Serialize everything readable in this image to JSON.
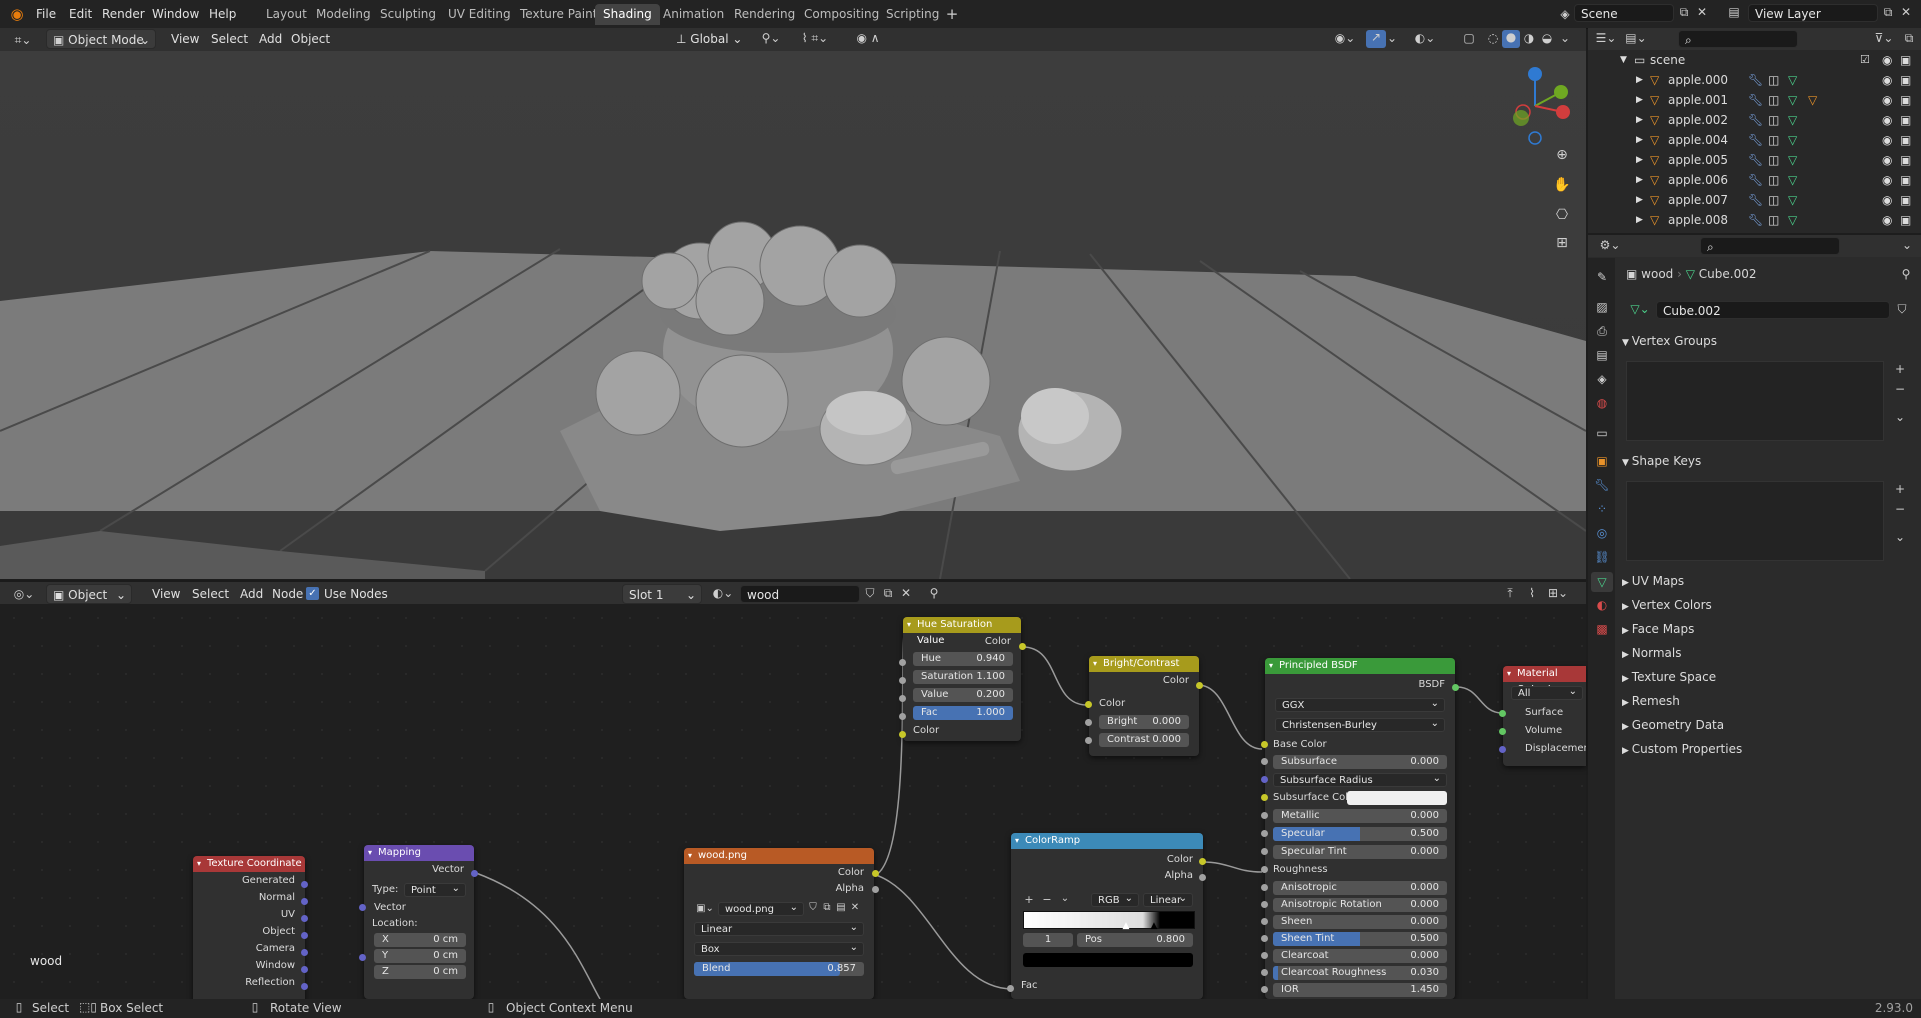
{
  "topbar": {
    "menus": [
      "File",
      "Edit",
      "Render",
      "Window",
      "Help"
    ],
    "workspaces": [
      "Layout",
      "Modeling",
      "Sculpting",
      "UV Editing",
      "Texture Paint",
      "Shading",
      "Animation",
      "Rendering",
      "Compositing",
      "Scripting"
    ],
    "active_workspace": "Shading",
    "scene": "Scene",
    "view_layer": "View Layer"
  },
  "viewport_header": {
    "mode": "Object Mode",
    "menus": [
      "View",
      "Select",
      "Add",
      "Object"
    ],
    "orientation": "Global"
  },
  "node_header": {
    "type": "Object",
    "menus": [
      "View",
      "Select",
      "Add",
      "Node"
    ],
    "use_nodes_label": "Use Nodes",
    "slot": "Slot 1",
    "material": "wood"
  },
  "node_editor": {
    "material_label": "wood",
    "nodes": {
      "tex_coord": {
        "title": "Texture Coordinate",
        "outputs": [
          "Generated",
          "Normal",
          "UV",
          "Object",
          "Camera",
          "Window",
          "Reflection"
        ]
      },
      "mapping": {
        "title": "Mapping",
        "output": "Vector",
        "type_label": "Type:",
        "type_value": "Point",
        "input": "Vector",
        "location_label": "Location:",
        "x_label": "X",
        "x": "0 cm",
        "y_label": "Y",
        "y": "0 cm",
        "z_label": "Z",
        "z": "0 cm"
      },
      "image": {
        "title": "wood.png",
        "out_color": "Color",
        "out_alpha": "Alpha",
        "file": "wood.png",
        "interp": "Linear",
        "projection": "Box",
        "blend_label": "Blend",
        "blend": "0.857"
      },
      "hsv": {
        "title": "Hue Saturation Value",
        "out_color": "Color",
        "hue_label": "Hue",
        "hue": "0.940",
        "sat_label": "Saturation",
        "sat": "1.100",
        "val_label": "Value",
        "val": "0.200",
        "fac_label": "Fac",
        "fac": "1.000",
        "in_color": "Color"
      },
      "bc": {
        "title": "Bright/Contrast",
        "out_color": "Color",
        "in_color": "Color",
        "bright_label": "Bright",
        "bright": "0.000",
        "contrast_label": "Contrast",
        "contrast": "0.000"
      },
      "ramp": {
        "title": "ColorRamp",
        "out_color": "Color",
        "out_alpha": "Alpha",
        "mode": "RGB",
        "interp": "Linear",
        "index": "1",
        "pos_label": "Pos",
        "pos": "0.800",
        "fac": "Fac"
      },
      "bsdf": {
        "title": "Principled BSDF",
        "out": "BSDF",
        "distribution": "GGX",
        "subsurface_method": "Christensen-Burley",
        "rows": [
          {
            "label": "Base Color",
            "value": ""
          },
          {
            "label": "Subsurface",
            "value": "0.000"
          },
          {
            "label": "Subsurface Radius",
            "value": ""
          },
          {
            "label": "Subsurface Colo",
            "value": ""
          },
          {
            "label": "Metallic",
            "value": "0.000"
          },
          {
            "label": "Specular",
            "value": "0.500"
          },
          {
            "label": "Specular Tint",
            "value": "0.000"
          },
          {
            "label": "Roughness",
            "value": ""
          },
          {
            "label": "Anisotropic",
            "value": "0.000"
          },
          {
            "label": "Anisotropic Rotation",
            "value": "0.000"
          },
          {
            "label": "Sheen",
            "value": "0.000"
          },
          {
            "label": "Sheen Tint",
            "value": "0.500"
          },
          {
            "label": "Clearcoat",
            "value": "0.000"
          },
          {
            "label": "Clearcoat Roughness",
            "value": "0.030"
          },
          {
            "label": "IOR",
            "value": "1.450"
          }
        ]
      },
      "output": {
        "title": "Material Output",
        "target": "All",
        "inputs": [
          "Surface",
          "Volume",
          "Displacement"
        ]
      }
    }
  },
  "outliner": {
    "root": "scene",
    "items": [
      "apple.000",
      "apple.001",
      "apple.002",
      "apple.004",
      "apple.005",
      "apple.006",
      "apple.007",
      "apple.008"
    ]
  },
  "properties": {
    "breadcrumb_object": "wood",
    "breadcrumb_mesh": "Cube.002",
    "mesh_name": "Cube.002",
    "panels_open": [
      "Vertex Groups",
      "Shape Keys"
    ],
    "panels_closed": [
      "UV Maps",
      "Vertex Colors",
      "Face Maps",
      "Normals",
      "Texture Space",
      "Remesh",
      "Geometry Data",
      "Custom Properties"
    ]
  },
  "statusbar": {
    "select": "Select",
    "box_select": "Box Select",
    "rotate": "Rotate View",
    "context": "Object Context Menu",
    "version": "2.93.0"
  }
}
